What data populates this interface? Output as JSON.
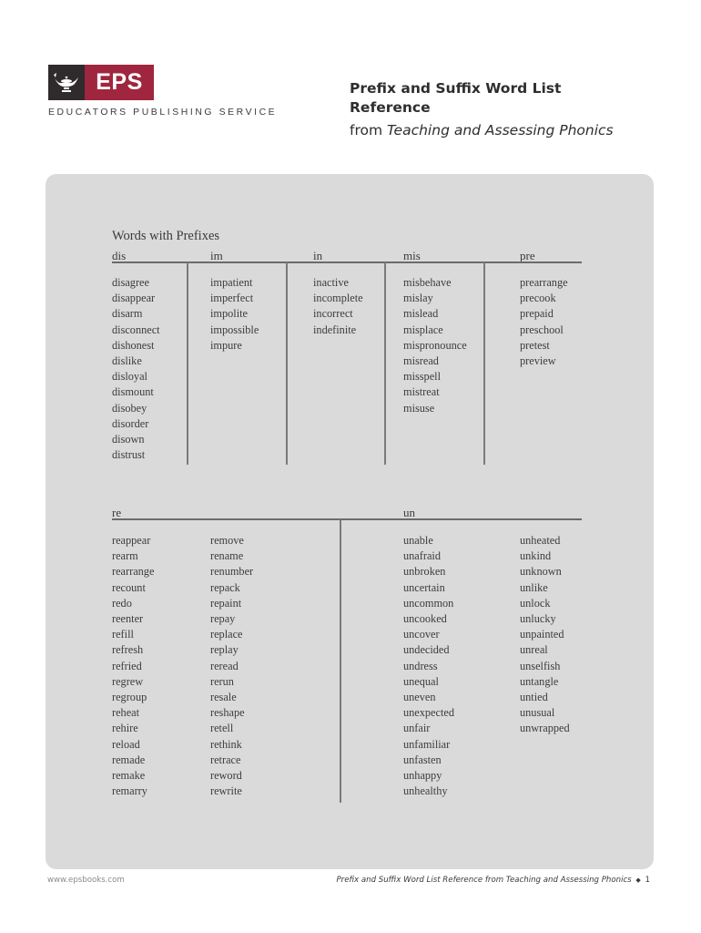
{
  "brand": {
    "logo_text": "EPS",
    "publisher_name": "EDUCATORS PUBLISHING SERVICE",
    "colors": {
      "logo_red": "#a0253f",
      "logo_dark": "#2f2b2c",
      "panel_bg": "#d9dad9"
    }
  },
  "header": {
    "title": "Prefix and Suffix Word List Reference",
    "subtitle_prefix": "from ",
    "subtitle_book": "Teaching and Assessing Phonics"
  },
  "section": {
    "heading": "Words with Prefixes"
  },
  "prefixes_top": [
    {
      "prefix": "dis",
      "words": [
        "disagree",
        "disappear",
        "disarm",
        "disconnect",
        "dishonest",
        "dislike",
        "disloyal",
        "dismount",
        "disobey",
        "disorder",
        "disown",
        "distrust"
      ]
    },
    {
      "prefix": "im",
      "words": [
        "impatient",
        "imperfect",
        "impolite",
        "impossible",
        "impure"
      ]
    },
    {
      "prefix": "in",
      "words": [
        "inactive",
        "incomplete",
        "incorrect",
        "indefinite"
      ]
    },
    {
      "prefix": "mis",
      "words": [
        "misbehave",
        "mislay",
        "mislead",
        "misplace",
        "mispronounce",
        "misread",
        "misspell",
        "mistreat",
        "misuse"
      ]
    },
    {
      "prefix": "pre",
      "words": [
        "prearrange",
        "precook",
        "prepaid",
        "preschool",
        "pretest",
        "preview"
      ]
    }
  ],
  "prefixes_bottom": [
    {
      "prefix": "re",
      "columns": [
        [
          "reappear",
          "rearm",
          "rearrange",
          "recount",
          "redo",
          "reenter",
          "refill",
          "refresh",
          "refried",
          "regrew",
          "regroup",
          "reheat",
          "rehire",
          "reload",
          "remade",
          "remake",
          "remarry"
        ],
        [
          "remove",
          "rename",
          "renumber",
          "repack",
          "repaint",
          "repay",
          "replace",
          "replay",
          "reread",
          "rerun",
          "resale",
          "reshape",
          "retell",
          "rethink",
          "retrace",
          "reword",
          "rewrite"
        ]
      ]
    },
    {
      "prefix": "un",
      "columns": [
        [
          "unable",
          "unafraid",
          "unbroken",
          "uncertain",
          "uncommon",
          "uncooked",
          "uncover",
          "undecided",
          "undress",
          "unequal",
          "uneven",
          "unexpected",
          "unfair",
          "unfamiliar",
          "unfasten",
          "unhappy",
          "unhealthy"
        ],
        [
          "unheated",
          "unkind",
          "unknown",
          "unlike",
          "unlock",
          "unlucky",
          "unpainted",
          "unreal",
          "unselfish",
          "untangle",
          "untied",
          "unusual",
          "unwrapped"
        ]
      ]
    }
  ],
  "footer": {
    "website": "www.epsbooks.com",
    "running_title": "Prefix and Suffix Word List Reference from Teaching and Assessing Phonics",
    "separator": "◆",
    "page_number": "1"
  }
}
